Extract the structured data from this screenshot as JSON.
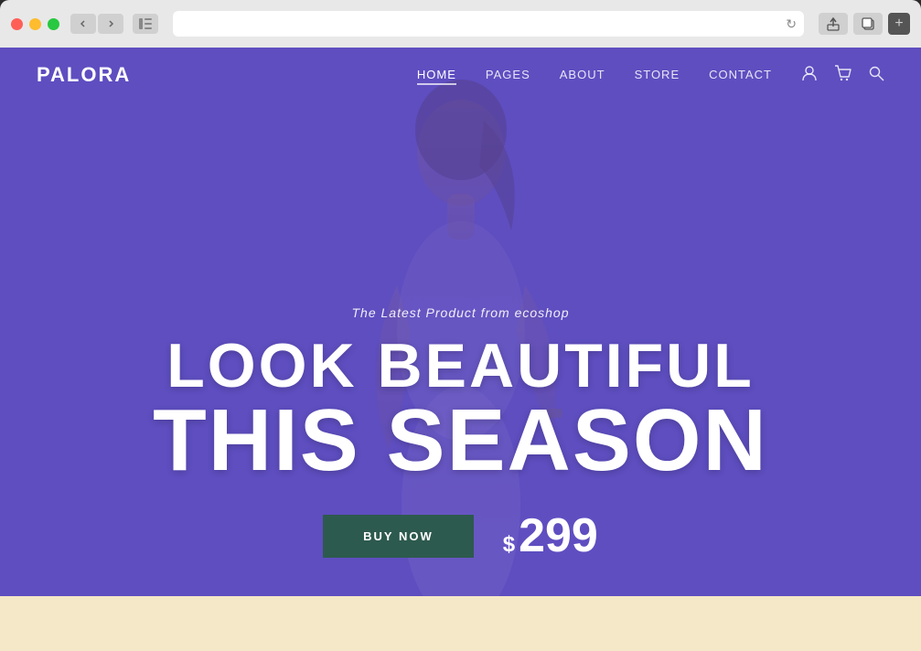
{
  "browser": {
    "traffic_lights": [
      "red",
      "yellow",
      "green"
    ],
    "reload_icon": "↻",
    "actions": [
      "share",
      "duplicate"
    ],
    "add_tab": "+"
  },
  "navbar": {
    "logo": "PALORA",
    "menu_items": [
      {
        "label": "HOME",
        "active": true
      },
      {
        "label": "PAGES",
        "active": false
      },
      {
        "label": "ABOUT",
        "active": false
      },
      {
        "label": "STORE",
        "active": false
      },
      {
        "label": "CONTACT",
        "active": false
      }
    ],
    "icons": [
      "user",
      "cart",
      "search"
    ]
  },
  "hero": {
    "subtitle": "The Latest Product from ecoshop",
    "title_line1": "LOOK BEAUTIFUL",
    "title_line2": "THIS SEASON",
    "cta_button": "BUY NOW",
    "price_symbol": "$",
    "price_value": "299"
  }
}
